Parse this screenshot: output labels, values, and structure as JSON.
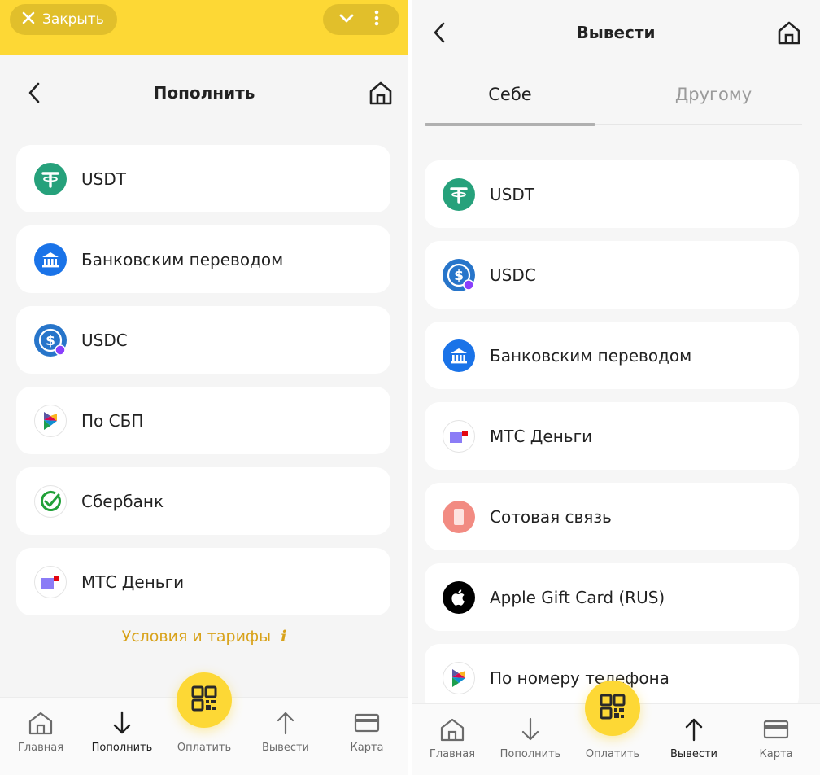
{
  "left": {
    "close_label": "Закрыть",
    "title": "Пополнить",
    "items": [
      {
        "label": "USDT",
        "icon": "tether-icon"
      },
      {
        "label": "Банковским переводом",
        "icon": "bank-icon"
      },
      {
        "label": "USDC",
        "icon": "usdc-icon"
      },
      {
        "label": "По СБП",
        "icon": "sbp-icon"
      },
      {
        "label": "Сбербанк",
        "icon": "sberbank-icon"
      },
      {
        "label": "МТС Деньги",
        "icon": "mts-money-icon"
      }
    ],
    "terms": "Условия и тарифы",
    "terms_info": "i",
    "nav": [
      {
        "label": "Главная",
        "icon": "home-icon"
      },
      {
        "label": "Пополнить",
        "icon": "arrow-down-icon",
        "active": true
      },
      {
        "label": "Оплатить",
        "icon": "qr-icon"
      },
      {
        "label": "Вывести",
        "icon": "arrow-up-icon"
      },
      {
        "label": "Карта",
        "icon": "card-icon"
      }
    ]
  },
  "right": {
    "title": "Вывести",
    "tabs": [
      {
        "label": "Себе",
        "active": true
      },
      {
        "label": "Другому",
        "active": false
      }
    ],
    "items": [
      {
        "label": "USDT",
        "icon": "tether-icon"
      },
      {
        "label": "USDC",
        "icon": "usdc-icon"
      },
      {
        "label": "Банковским переводом",
        "icon": "bank-icon"
      },
      {
        "label": "МТС Деньги",
        "icon": "mts-money-icon"
      },
      {
        "label": "Сотовая связь",
        "icon": "mobile-phone-icon"
      },
      {
        "label": "Apple Gift Card (RUS)",
        "icon": "apple-icon"
      },
      {
        "label": "По номеру телефона",
        "icon": "sbp-icon"
      }
    ],
    "nav": [
      {
        "label": "Главная",
        "icon": "home-icon"
      },
      {
        "label": "Пополнить",
        "icon": "arrow-down-icon"
      },
      {
        "label": "Оплатить",
        "icon": "qr-icon"
      },
      {
        "label": "Вывести",
        "icon": "arrow-up-icon",
        "active": true
      },
      {
        "label": "Карта",
        "icon": "card-icon"
      }
    ]
  },
  "colors": {
    "accent_yellow": "#fdd835",
    "terms_text": "#d8a21a",
    "tether_green": "#26a17b",
    "bank_blue": "#1a73e8",
    "usdc_blue": "#2775ca",
    "sber_green": "#21a038",
    "mts_purple": "#8b7cf6",
    "mts_red": "#e30611",
    "mobile_pink": "#f28b82"
  }
}
